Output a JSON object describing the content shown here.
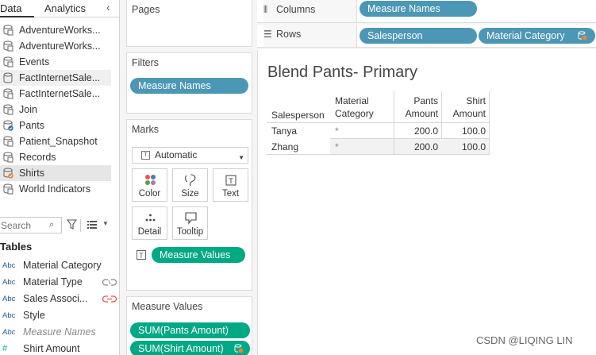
{
  "tabs": {
    "data": "Data",
    "analytics": "Analytics"
  },
  "sources": [
    {
      "label": "AdventureWorks..."
    },
    {
      "label": "AdventureWorks..."
    },
    {
      "label": "Events"
    },
    {
      "label": "FactInternetSale..."
    },
    {
      "label": "FactInternetSale..."
    },
    {
      "label": "Join"
    },
    {
      "label": "Pants"
    },
    {
      "label": "Patient_Snapshot"
    },
    {
      "label": "Records"
    },
    {
      "label": "Shirts"
    },
    {
      "label": "World Indicators"
    }
  ],
  "search": {
    "placeholder": "Search"
  },
  "tables": {
    "heading": "Tables",
    "fields": [
      {
        "type": "Abc",
        "label": "Material Category"
      },
      {
        "type": "Abc",
        "label": "Material Type"
      },
      {
        "type": "Abc",
        "label": "Sales Associ..."
      },
      {
        "type": "Abc",
        "label": "Style"
      },
      {
        "type": "Abc",
        "label": "Measure Names"
      },
      {
        "type": "#",
        "label": "Shirt Amount"
      }
    ]
  },
  "cards": {
    "pages": "Pages",
    "filters": "Filters",
    "filter_pill": "Measure Names",
    "marks": "Marks",
    "mark_type": "Automatic",
    "mark_buttons": {
      "color": "Color",
      "size": "Size",
      "text": "Text",
      "detail": "Detail",
      "tooltip": "Tooltip"
    },
    "marks_text_pill": "Measure Values",
    "measure_values": "Measure Values",
    "mv_pills": [
      "SUM(Pants Amount)",
      "SUM(Shirt Amount)"
    ]
  },
  "shelves": {
    "columns_label": "Columns",
    "columns_pill": "Measure Names",
    "rows_label": "Rows",
    "rows_pills": [
      "Salesperson",
      "Material Category"
    ]
  },
  "view": {
    "title": "Blend Pants- Primary",
    "headers": {
      "salesperson": "Salesperson",
      "material_1": "Material",
      "material_2": "Category",
      "pants_1": "Pants",
      "pants_2": "Amount",
      "shirt_1": "Shirt",
      "shirt_2": "Amount"
    },
    "rows": [
      {
        "salesperson": "Tanya",
        "category": "*",
        "pants": "200.0",
        "shirt": "100.0"
      },
      {
        "salesperson": "Zhang",
        "category": "*",
        "pants": "200.0",
        "shirt": "100.0"
      }
    ]
  },
  "colors": {
    "dimension_pill": "#4b97b5",
    "measure_pill": "#00a884",
    "link": "#e8544f",
    "blend_badge": "#e8833a"
  },
  "watermark": "CSDN @LIQING LIN"
}
